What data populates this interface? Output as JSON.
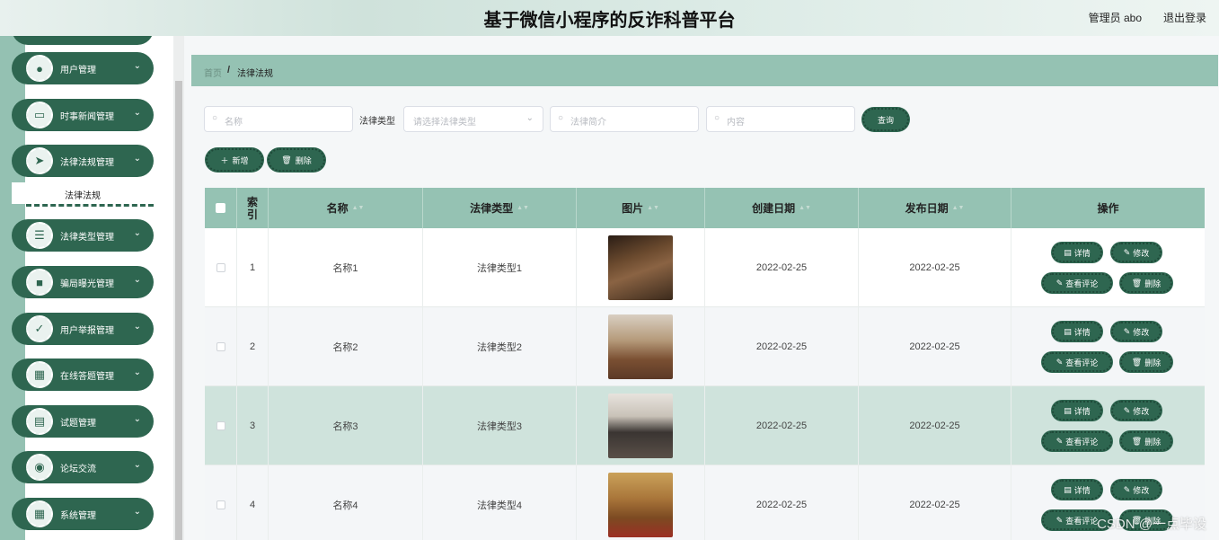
{
  "header": {
    "title": "基于微信小程序的反诈科普平台",
    "user": "管理员 abo",
    "logout": "退出登录"
  },
  "sidebar": {
    "items": [
      {
        "label": "用户管理",
        "icon": "user-icon"
      },
      {
        "label": "时事新闻管理",
        "icon": "news-icon"
      },
      {
        "label": "法律法规管理",
        "icon": "send-icon"
      },
      {
        "label": "法律类型管理",
        "icon": "list-icon"
      },
      {
        "label": "骗局曝光管理",
        "icon": "briefcase-icon"
      },
      {
        "label": "用户举报管理",
        "icon": "report-icon"
      },
      {
        "label": "在线答题管理",
        "icon": "grid-icon"
      },
      {
        "label": "试题管理",
        "icon": "doc-icon"
      },
      {
        "label": "论坛交流",
        "icon": "location-icon"
      },
      {
        "label": "系统管理",
        "icon": "grid-icon"
      }
    ],
    "submenu": "法律法规"
  },
  "breadcrumb": {
    "home": "首页",
    "separator": "/",
    "current": "法律法规"
  },
  "search": {
    "name_placeholder": "名称",
    "type_label": "法律类型",
    "type_placeholder": "请选择法律类型",
    "intro_placeholder": "法律简介",
    "content_placeholder": "内容",
    "query": "查询"
  },
  "actions": {
    "add": "新增",
    "delete": "删除"
  },
  "table": {
    "headers": {
      "index": "索引",
      "name": "名称",
      "type": "法律类型",
      "image": "图片",
      "created": "创建日期",
      "published": "发布日期",
      "ops": "操作"
    },
    "rows": [
      {
        "index": "1",
        "name": "名称1",
        "type": "法律类型1",
        "created": "2022-02-25",
        "published": "2022-02-25"
      },
      {
        "index": "2",
        "name": "名称2",
        "type": "法律类型2",
        "created": "2022-02-25",
        "published": "2022-02-25"
      },
      {
        "index": "3",
        "name": "名称3",
        "type": "法律类型3",
        "created": "2022-02-25",
        "published": "2022-02-25"
      },
      {
        "index": "4",
        "name": "名称4",
        "type": "法律类型4",
        "created": "2022-02-25",
        "published": "2022-02-25"
      }
    ],
    "row_buttons": {
      "detail": "详情",
      "edit": "修改",
      "comments": "查看评论",
      "delete": "删除"
    }
  },
  "watermark": "CSDN @一点毕设",
  "colors": {
    "primary": "#2e6650",
    "header_bg": "#95c2b3",
    "highlight_row": "#cfe3dc"
  }
}
